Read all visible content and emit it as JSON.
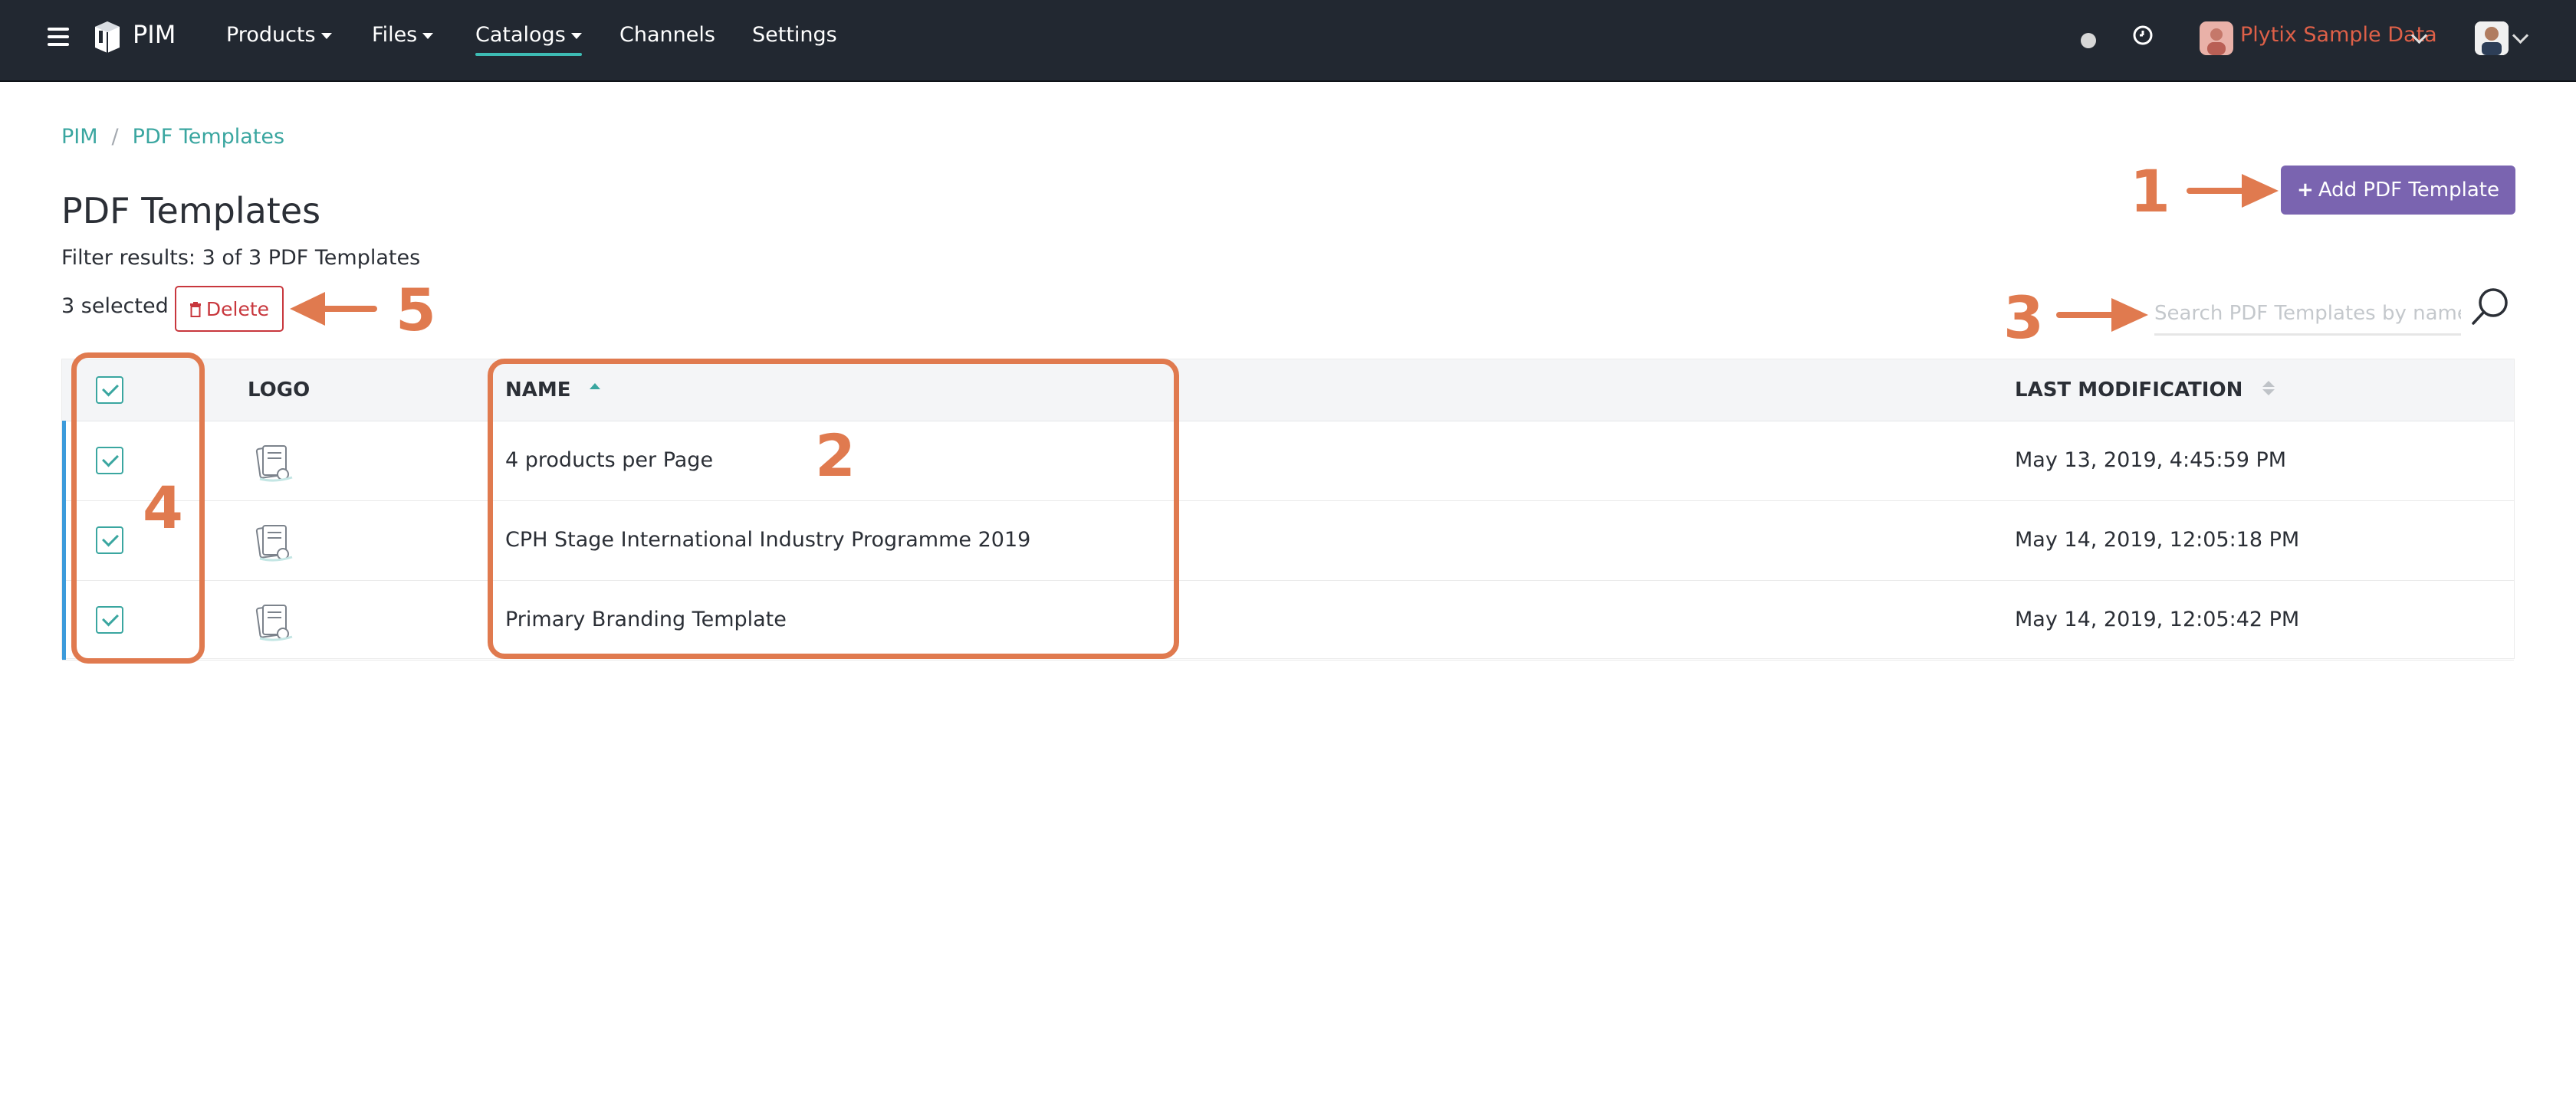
{
  "nav": {
    "brand": "PIM",
    "items": [
      {
        "label": "Products",
        "has_caret": true
      },
      {
        "label": "Files",
        "has_caret": true
      },
      {
        "label": "Catalogs",
        "has_caret": true,
        "active": true
      },
      {
        "label": "Channels",
        "has_caret": false
      },
      {
        "label": "Settings",
        "has_caret": false
      }
    ],
    "account_name": "Plytix Sample Data",
    "icons": [
      "menu-icon",
      "box-logo-icon",
      "status-dot-icon",
      "clock-icon",
      "account-avatar",
      "user-avatar",
      "chevron-down-icon"
    ]
  },
  "breadcrumb": [
    "PIM",
    "PDF Templates"
  ],
  "page": {
    "title": "PDF Templates",
    "filter_results": "Filter results: 3 of 3 PDF Templates",
    "selected_count": "3 selected",
    "delete_label": "Delete",
    "add_label": "Add PDF Template",
    "search_placeholder": "Search PDF Templates by name"
  },
  "table": {
    "columns": [
      "LOGO",
      "NAME",
      "LAST MODIFICATION"
    ],
    "rows": [
      {
        "name": "4 products per Page",
        "modified": "May 13, 2019, 4:45:59 PM",
        "checked": true
      },
      {
        "name": "CPH Stage International Industry Programme 2019",
        "modified": "May 14, 2019, 12:05:18 PM",
        "checked": true
      },
      {
        "name": "Primary Branding Template",
        "modified": "May 14, 2019, 12:05:42 PM",
        "checked": true
      }
    ]
  },
  "annotations": [
    "1",
    "2",
    "3",
    "4",
    "5"
  ],
  "colors": {
    "topbar": "#222831",
    "accent_teal": "#3aa6a0",
    "add_button": "#7a64b0",
    "delete": "#c8373d",
    "annotation": "#e07a4f",
    "row_marker": "#3c9bdb",
    "account_name": "#de6048"
  }
}
